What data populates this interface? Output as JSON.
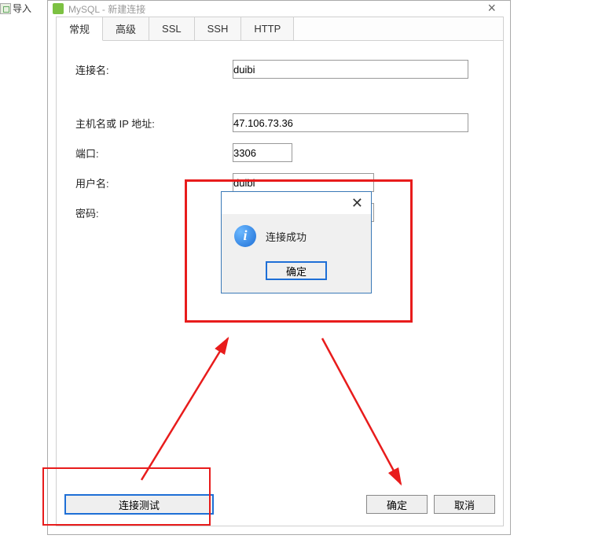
{
  "bgText": "导入",
  "window": {
    "title": "MySQL - 新建连接"
  },
  "tabs": [
    "常规",
    "高级",
    "SSL",
    "SSH",
    "HTTP"
  ],
  "activeTab": 0,
  "form": {
    "connLabel": "连接名:",
    "connValue": "duibi",
    "hostLabel": "主机名或 IP 地址:",
    "hostValue": "47.106.73.36",
    "portLabel": "端口:",
    "portValue": "3306",
    "userLabel": "用户名:",
    "userValue": "duibi",
    "pwdLabel": "密码:",
    "pwdValue": "●●●●●●●●●●●●●●●"
  },
  "msgbox": {
    "text": "连接成功",
    "ok": "确定"
  },
  "footer": {
    "test": "连接测试",
    "ok": "确定",
    "cancel": "取消"
  }
}
